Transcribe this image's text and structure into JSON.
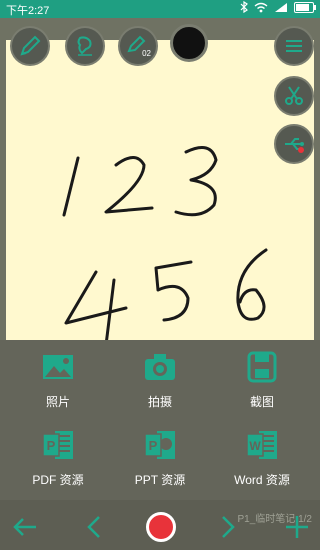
{
  "status": {
    "time": "下午2:27",
    "battery_level": 0.8,
    "icons": [
      "bluetooth-icon",
      "wifi-icon",
      "signal-icon",
      "battery-icon"
    ]
  },
  "toolbar": {
    "tools": [
      "pen-icon",
      "eraser-icon",
      "pen-2-icon",
      "color-black"
    ],
    "tool_badge": "02",
    "menu_icon": "menu-icon",
    "side_tools": [
      "scissors-icon",
      "usb-icon"
    ]
  },
  "panel": {
    "items": [
      {
        "label": "照片",
        "icon": "photo-icon"
      },
      {
        "label": "拍摄",
        "icon": "camera-icon"
      },
      {
        "label": "截图",
        "icon": "screenshot-icon"
      },
      {
        "label": "PDF 资源",
        "icon": "pdf-icon"
      },
      {
        "label": "PPT 资源",
        "icon": "ppt-icon"
      },
      {
        "label": "Word 资源",
        "icon": "word-icon"
      }
    ]
  },
  "bottom": {
    "page_info": "P1_临时笔记 1/2"
  },
  "colors": {
    "accent": "#1fa98b",
    "status_bar": "#1f9f82",
    "paper": "#fff9cf",
    "record": "#e8333a"
  }
}
